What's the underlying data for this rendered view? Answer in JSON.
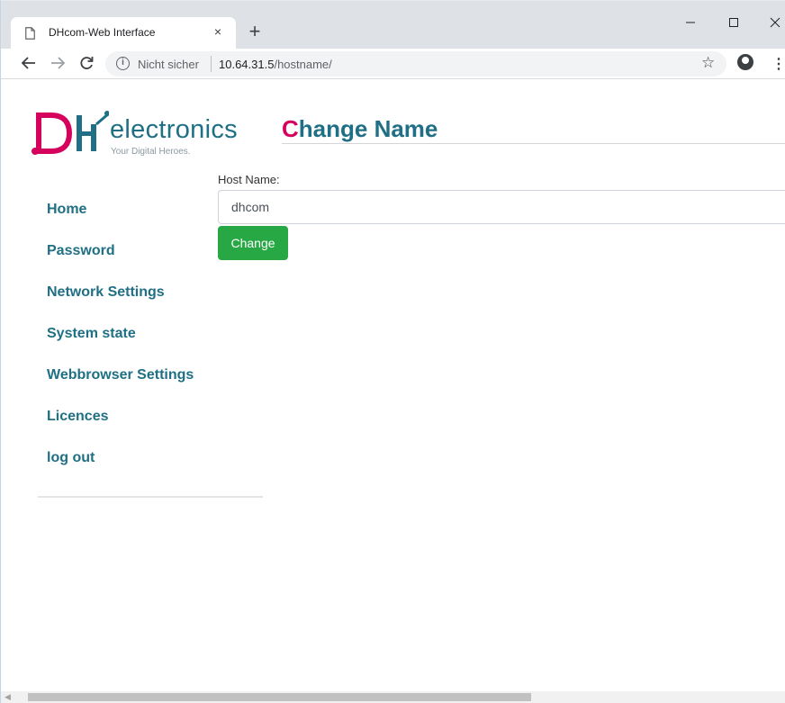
{
  "browser": {
    "tab_title": "DHcom-Web Interface",
    "tab_close": "×",
    "new_tab": "+",
    "security_label": "Nicht sicher",
    "url_host": "10.64.31.5",
    "url_path": "/hostname/"
  },
  "logo": {
    "brand_word": "electronics",
    "tagline": "Your Digital Heroes."
  },
  "page": {
    "title_first_letter": "C",
    "title_rest": "hange Name"
  },
  "sidebar": {
    "items": [
      {
        "label": "Home"
      },
      {
        "label": "Password"
      },
      {
        "label": "Network Settings"
      },
      {
        "label": "System state"
      },
      {
        "label": "Webbrowser Settings"
      },
      {
        "label": "Licences"
      },
      {
        "label": "log out"
      }
    ]
  },
  "form": {
    "host_label": "Host Name:",
    "host_value": "dhcom",
    "submit_label": "Change"
  },
  "colors": {
    "brand_teal": "#1f6f85",
    "brand_magenta": "#d6005d",
    "button_green": "#28a745"
  },
  "scrollbar": {
    "horizontal_visible_fraction": 0.65
  }
}
